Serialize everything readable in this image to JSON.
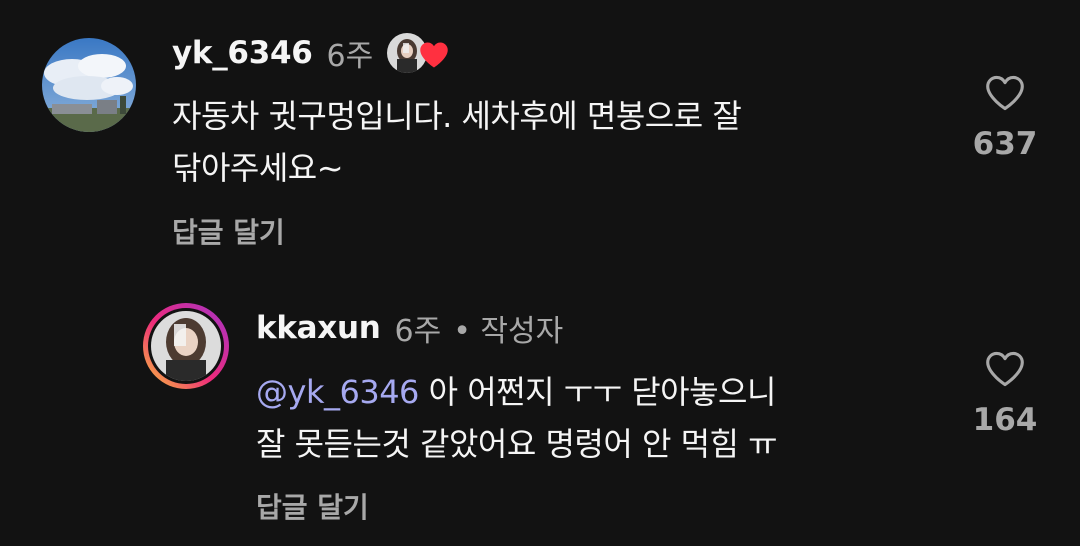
{
  "comments": [
    {
      "username": "yk_6346",
      "time": "6주",
      "author_liked": true,
      "lines": [
        "자동차 귓구멍입니다. 세차후에 면봉으로 잘",
        "닦아주세요~"
      ],
      "reply_label": "답글 달기",
      "like_count": "637"
    },
    {
      "username": "kkaxun",
      "time": "6주",
      "author_badge": "• 작성자",
      "mention": "@yk_6346",
      "line1_rest": " 아 어쩐지 ㅜㅜ 닫아놓으니",
      "line2": "잘 못듣는것 같았어요 명령어 안 먹힘 ㅠ",
      "reply_label": "답글 달기",
      "like_count": "164"
    }
  ],
  "colors": {
    "background": "#121212",
    "text_primary": "#f5f5f5",
    "text_secondary": "#a8a8a8",
    "mention": "#a6a9f0",
    "heart_liked": "#ff3040"
  },
  "icons": {
    "like": "heart-outline-icon",
    "author_like": "heart-filled-icon"
  }
}
